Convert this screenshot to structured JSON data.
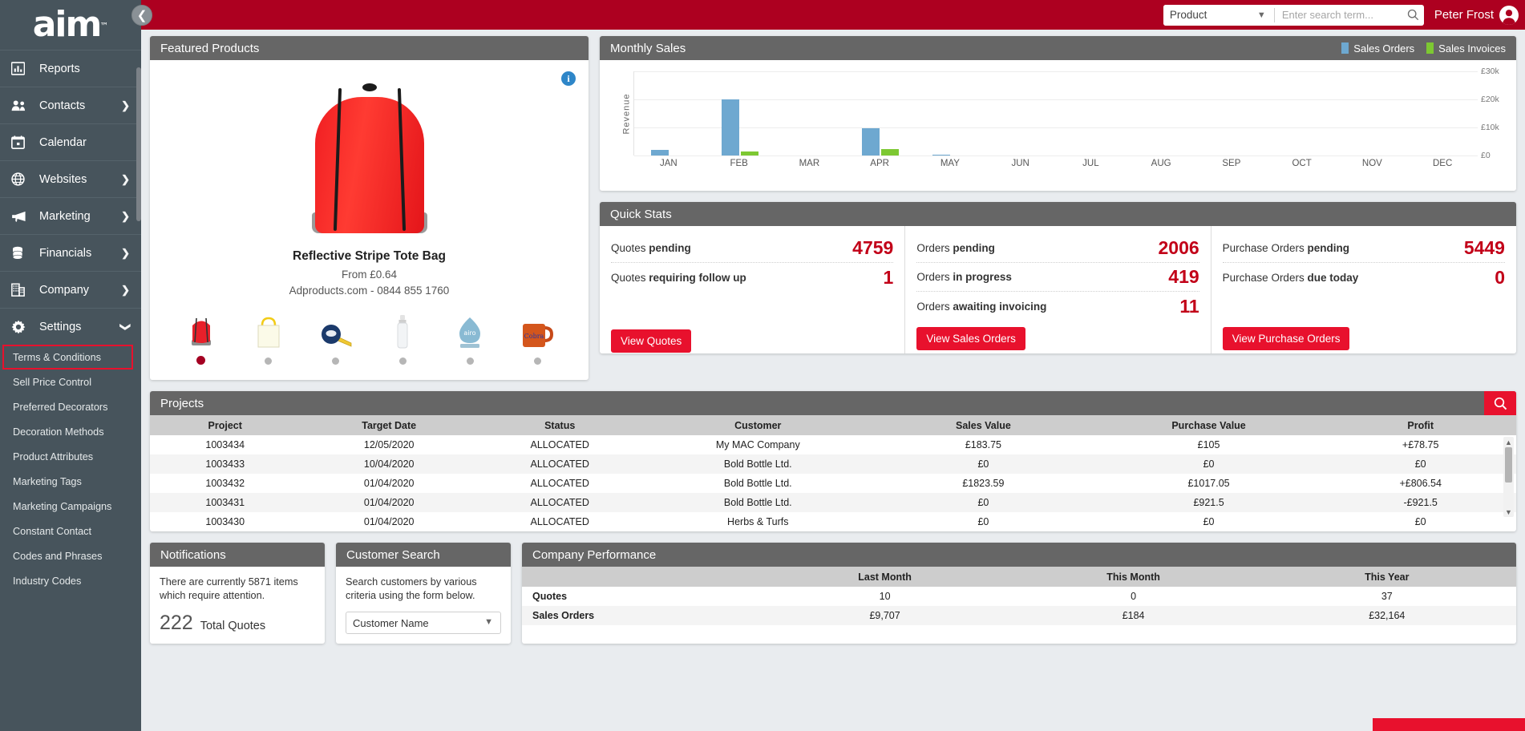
{
  "brand": {
    "logo_text": "aim",
    "tm": "™",
    "accent_red": "#e8112d",
    "header_red": "#ad0020",
    "sidebar_bg": "#47545c",
    "panel_head": "#666666"
  },
  "sidebar": {
    "collapse_icon": "chevron-left-icon",
    "items": [
      {
        "label": "Reports",
        "icon": "bar-chart-icon",
        "has_chevron": false
      },
      {
        "label": "Contacts",
        "icon": "people-icon",
        "has_chevron": true
      },
      {
        "label": "Calendar",
        "icon": "calendar-icon",
        "has_chevron": false
      },
      {
        "label": "Websites",
        "icon": "globe-icon",
        "has_chevron": true
      },
      {
        "label": "Marketing",
        "icon": "megaphone-icon",
        "has_chevron": true
      },
      {
        "label": "Financials",
        "icon": "coins-icon",
        "has_chevron": true
      },
      {
        "label": "Company",
        "icon": "building-icon",
        "has_chevron": true
      },
      {
        "label": "Settings",
        "icon": "gear-icon",
        "has_chevron": true,
        "expanded": true
      }
    ],
    "settings_sub": [
      {
        "label": "Terms & Conditions",
        "highlighted": true
      },
      {
        "label": "Sell Price Control",
        "highlighted": false
      },
      {
        "label": "Preferred Decorators",
        "highlighted": false
      },
      {
        "label": "Decoration Methods",
        "highlighted": false
      },
      {
        "label": "Product Attributes",
        "highlighted": false
      },
      {
        "label": "Marketing Tags",
        "highlighted": false
      },
      {
        "label": "Marketing Campaigns",
        "highlighted": false
      },
      {
        "label": "Constant Contact",
        "highlighted": false
      },
      {
        "label": "Codes and Phrases",
        "highlighted": false
      },
      {
        "label": "Industry Codes",
        "highlighted": false
      }
    ]
  },
  "topbar": {
    "search_category": "Product",
    "search_category_options": [
      "Product"
    ],
    "search_placeholder": "Enter search term...",
    "search_value": "",
    "search_icon": "magnifier-icon",
    "user_name": "Peter Frost",
    "avatar_icon": "user-avatar-icon"
  },
  "featured": {
    "title": "Featured Products",
    "info_icon": "info-icon",
    "product_name": "Reflective Stripe Tote Bag",
    "price": "From £0.64",
    "supplier": "Adproducts.com - 0844 855 1760",
    "thumbnails": [
      {
        "name": "red-drawstring-bag-thumb",
        "active": true
      },
      {
        "name": "yellow-tote-bag-thumb",
        "active": false
      },
      {
        "name": "tape-measure-thumb",
        "active": false
      },
      {
        "name": "water-bottle-thumb",
        "active": false
      },
      {
        "name": "glass-award-thumb",
        "active": false
      },
      {
        "name": "orange-mug-thumb",
        "active": false
      }
    ]
  },
  "chart_data": {
    "type": "bar",
    "title": "Monthly Sales",
    "xlabel": "",
    "ylabel": "Revenue",
    "ylim": [
      0,
      30000
    ],
    "yticks": [
      0,
      10000,
      20000,
      30000
    ],
    "ytick_labels": [
      "£0",
      "£10k",
      "£20k",
      "£30k"
    ],
    "grid": true,
    "legend_position": "top-right",
    "categories": [
      "JAN",
      "FEB",
      "MAR",
      "APR",
      "MAY",
      "JUN",
      "JUL",
      "AUG",
      "SEP",
      "OCT",
      "NOV",
      "DEC"
    ],
    "series": [
      {
        "name": "Sales Orders",
        "color": "#6ea8d0",
        "values": [
          2100,
          20000,
          0,
          9700,
          400,
          0,
          0,
          0,
          0,
          0,
          0,
          0
        ]
      },
      {
        "name": "Sales Invoices",
        "color": "#7dc832",
        "values": [
          0,
          1300,
          0,
          2400,
          0,
          0,
          0,
          0,
          0,
          0,
          0,
          0
        ]
      }
    ]
  },
  "quick_stats": {
    "title": "Quick Stats",
    "columns": [
      {
        "rows": [
          {
            "label_plain": "Quotes ",
            "label_bold": "pending",
            "value": "4759"
          },
          {
            "label_plain": "Quotes ",
            "label_bold": "requiring follow up",
            "value": "1"
          }
        ],
        "button": "View Quotes"
      },
      {
        "rows": [
          {
            "label_plain": "Orders ",
            "label_bold": "pending",
            "value": "2006"
          },
          {
            "label_plain": "Orders ",
            "label_bold": "in progress",
            "value": "419"
          },
          {
            "label_plain": "Orders ",
            "label_bold": "awaiting invoicing",
            "value": "11"
          }
        ],
        "button": "View Sales Orders"
      },
      {
        "rows": [
          {
            "label_plain": "Purchase Orders ",
            "label_bold": "pending",
            "value": "5449"
          },
          {
            "label_plain": "Purchase Orders ",
            "label_bold": "due today",
            "value": "0"
          }
        ],
        "button": "View Purchase Orders"
      }
    ]
  },
  "projects": {
    "title": "Projects",
    "search_icon": "magnifier-icon",
    "columns": [
      "Project",
      "Target Date",
      "Status",
      "Customer",
      "Sales Value",
      "Purchase Value",
      "Profit"
    ],
    "rows": [
      {
        "project": "1003434",
        "target_date": "12/05/2020",
        "status": "ALLOCATED",
        "customer": "My MAC Company",
        "sales_value": "£183.75",
        "purchase_value": "£105",
        "profit": "+£78.75",
        "profit_sign": "pos"
      },
      {
        "project": "1003433",
        "target_date": "10/04/2020",
        "status": "ALLOCATED",
        "customer": "Bold Bottle Ltd.",
        "sales_value": "£0",
        "purchase_value": "£0",
        "profit": "£0",
        "profit_sign": "zero"
      },
      {
        "project": "1003432",
        "target_date": "01/04/2020",
        "status": "ALLOCATED",
        "customer": "Bold Bottle Ltd.",
        "sales_value": "£1823.59",
        "purchase_value": "£1017.05",
        "profit": "+£806.54",
        "profit_sign": "pos"
      },
      {
        "project": "1003431",
        "target_date": "01/04/2020",
        "status": "ALLOCATED",
        "customer": "Bold Bottle Ltd.",
        "sales_value": "£0",
        "purchase_value": "£921.5",
        "profit": "-£921.5",
        "profit_sign": "neg"
      },
      {
        "project": "1003430",
        "target_date": "01/04/2020",
        "status": "ALLOCATED",
        "customer": "Herbs & Turfs",
        "sales_value": "£0",
        "purchase_value": "£0",
        "profit": "£0",
        "profit_sign": "zero"
      }
    ]
  },
  "notifications": {
    "title": "Notifications",
    "text": "There are currently 5871 items which require attention.",
    "stat_number": "222",
    "stat_label": "Total Quotes"
  },
  "customer_search": {
    "title": "Customer Search",
    "text": "Search customers by various criteria using the form below.",
    "select_value": "Customer Name",
    "select_options": [
      "Customer Name"
    ]
  },
  "company_performance": {
    "title": "Company Performance",
    "columns": [
      "",
      "Last Month",
      "This Month",
      "This Year"
    ],
    "rows": [
      {
        "label": "Quotes",
        "last_month": "10",
        "this_month": "0",
        "this_year": "37"
      },
      {
        "label": "Sales Orders",
        "last_month": "£9,707",
        "this_month": "£184",
        "this_year": "£32,164"
      }
    ]
  }
}
